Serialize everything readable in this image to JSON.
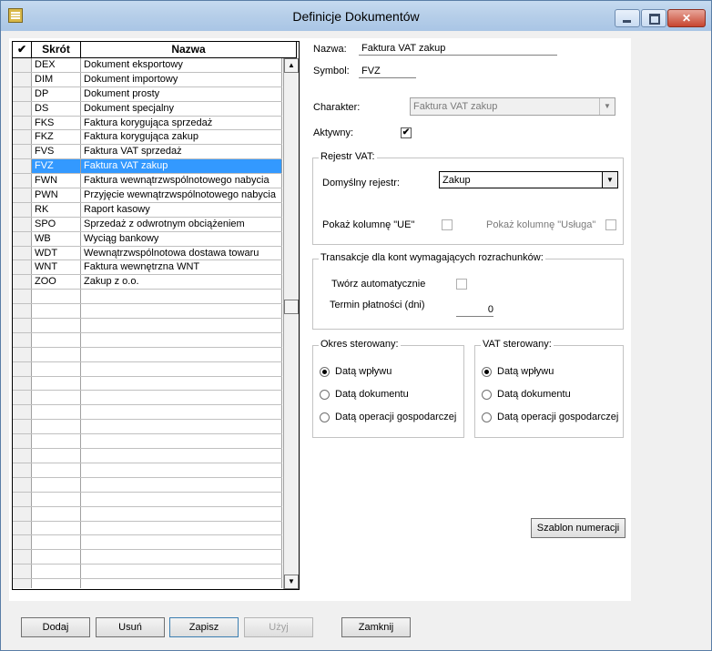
{
  "window": {
    "title": "Definicje Dokumentów"
  },
  "grid": {
    "headers": {
      "check": "✔",
      "skrot": "Skrót",
      "nazwa": "Nazwa"
    },
    "rows": [
      {
        "skrot": "DEX",
        "nazwa": "Dokument eksportowy"
      },
      {
        "skrot": "DIM",
        "nazwa": "Dokument importowy"
      },
      {
        "skrot": "DP",
        "nazwa": "Dokument prosty"
      },
      {
        "skrot": "DS",
        "nazwa": "Dokument specjalny"
      },
      {
        "skrot": "FKS",
        "nazwa": "Faktura korygująca sprzedaż"
      },
      {
        "skrot": "FKZ",
        "nazwa": "Faktura korygująca zakup"
      },
      {
        "skrot": "FVS",
        "nazwa": "Faktura VAT sprzedaż"
      },
      {
        "skrot": "FVZ",
        "nazwa": "Faktura VAT zakup"
      },
      {
        "skrot": "FWN",
        "nazwa": "Faktura wewnątrzwspólnotowego nabycia"
      },
      {
        "skrot": "PWN",
        "nazwa": "Przyjęcie wewnątrzwspólnotowego nabycia"
      },
      {
        "skrot": "RK",
        "nazwa": "Raport kasowy"
      },
      {
        "skrot": "SPO",
        "nazwa": "Sprzedaż z odwrotnym obciążeniem"
      },
      {
        "skrot": "WB",
        "nazwa": "Wyciąg bankowy"
      },
      {
        "skrot": "WDT",
        "nazwa": "Wewnątrzwspólnotowa dostawa towaru"
      },
      {
        "skrot": "WNT",
        "nazwa": "Faktura wewnętrzna WNT"
      },
      {
        "skrot": "ZOO",
        "nazwa": "Zakup z o.o."
      }
    ],
    "selected_index": 7,
    "empty_rows": 23
  },
  "details": {
    "nazwa_label": "Nazwa:",
    "nazwa_value": "Faktura VAT zakup",
    "symbol_label": "Symbol:",
    "symbol_value": "FVZ",
    "charakter_label": "Charakter:",
    "charakter_value": "Faktura VAT zakup",
    "aktywny_label": "Aktywny:",
    "aktywny_checked": "✔",
    "rejestr": {
      "title": "Rejestr VAT:",
      "domyslny_label": "Domyślny rejestr:",
      "domyslny_value": "Zakup",
      "ue_label": "Pokaż kolumnę \"UE\"",
      "usluga_label": "Pokaż kolumnę \"Usługa\""
    },
    "transakcje": {
      "title": "Transakcje dla kont wymagających rozrachunków:",
      "tworz_label": "Twórz automatycznie",
      "termin_label": "Termin płatności (dni)",
      "termin_value": "0"
    },
    "okres": {
      "title": "Okres sterowany:",
      "options": [
        "Datą wpływu",
        "Datą dokumentu",
        "Datą operacji gospodarczej"
      ],
      "selected": "Datą wpływu"
    },
    "vat": {
      "title": "VAT sterowany:",
      "options": [
        "Datą wpływu",
        "Datą dokumentu",
        "Datą operacji gospodarczej"
      ],
      "selected": "Datą wpływu"
    },
    "szablon_button": "Szablon numeracji"
  },
  "buttons": {
    "dodaj": "Dodaj",
    "usun": "Usuń",
    "zapisz": "Zapisz",
    "uzyj": "Użyj",
    "zamknij": "Zamknij"
  }
}
